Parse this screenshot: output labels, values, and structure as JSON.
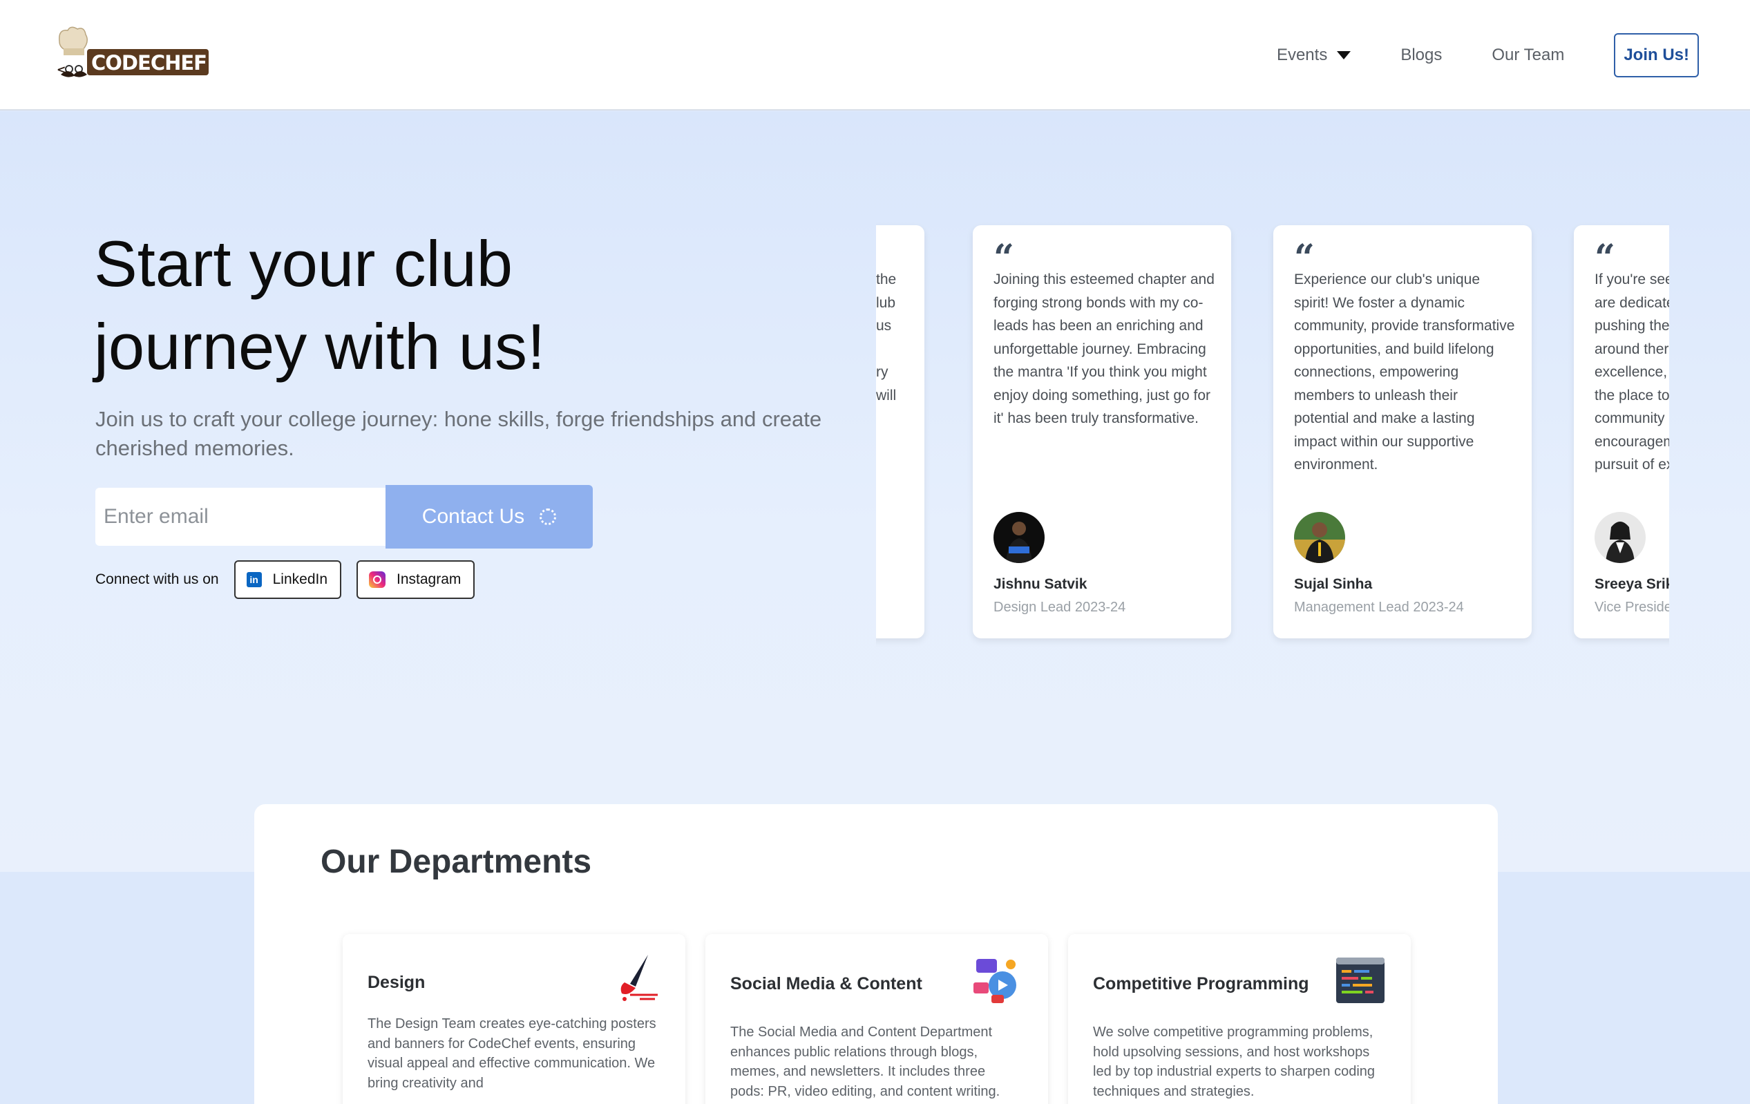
{
  "nav": {
    "logo_text": "CODECHEF",
    "links": [
      {
        "label": "Events"
      },
      {
        "label": "Blogs"
      },
      {
        "label": "Our Team"
      }
    ],
    "join_label": "Join Us!"
  },
  "hero": {
    "title_line1": "Start your club",
    "title_line2": "journey with us!",
    "subtitle": "Join us to craft your college journey: hone skills, forge friendships and create cherished memories.",
    "email_placeholder": "Enter email",
    "contact_label": "Contact Us",
    "connect_text": "Connect with us on",
    "linkedin_label": "LinkedIn",
    "instagram_label": "Instagram"
  },
  "testimonials": {
    "partial_left_fragments": [
      "the",
      "lub",
      "us",
      "",
      "ry",
      "will"
    ],
    "cards": [
      {
        "quote_mark": "“",
        "text": "Joining this esteemed chapter and forging strong bonds with my co-leads has been an enriching and unforgettable journey. Embracing the mantra 'If you think you might enjoy doing something, just go for it' has been truly transformative.",
        "name": "Jishnu Satvik",
        "role": "Design Lead 2023-24"
      },
      {
        "quote_mark": "“",
        "text": "Experience our club's unique spirit! We foster a dynamic community, provide transformative opportunities, and build lifelong connections, empowering members to unleash their potential and make a lasting impact within our supportive environment.",
        "name": "Sujal Sinha",
        "role": "Management Lead 2023-24"
      },
      {
        "quote_mark": "“",
        "text": "If you're see are dedicate pushing the around ther excellence, t the place to community encouragem pursuit of ex",
        "name": "Sreeya Srika",
        "role": "Vice Presiden"
      }
    ]
  },
  "departments": {
    "title": "Our Departments",
    "items": [
      {
        "name": "Design",
        "text": "The Design Team creates eye-catching posters and banners for CodeChef events, ensuring visual appeal and effective communication. We bring creativity and",
        "icon": "paintbrush-icon"
      },
      {
        "name": "Social Media & Content",
        "text": "The Social Media and Content Department enhances public relations through blogs, memes, and newsletters. It includes three pods: PR, video editing, and content writing.",
        "icon": "social-media-icon"
      },
      {
        "name": "Competitive Programming",
        "text": "We solve competitive programming problems, hold upsolving sessions, and host workshops led by top industrial experts to sharpen coding techniques and strategies.",
        "icon": "code-editor-icon"
      }
    ]
  }
}
